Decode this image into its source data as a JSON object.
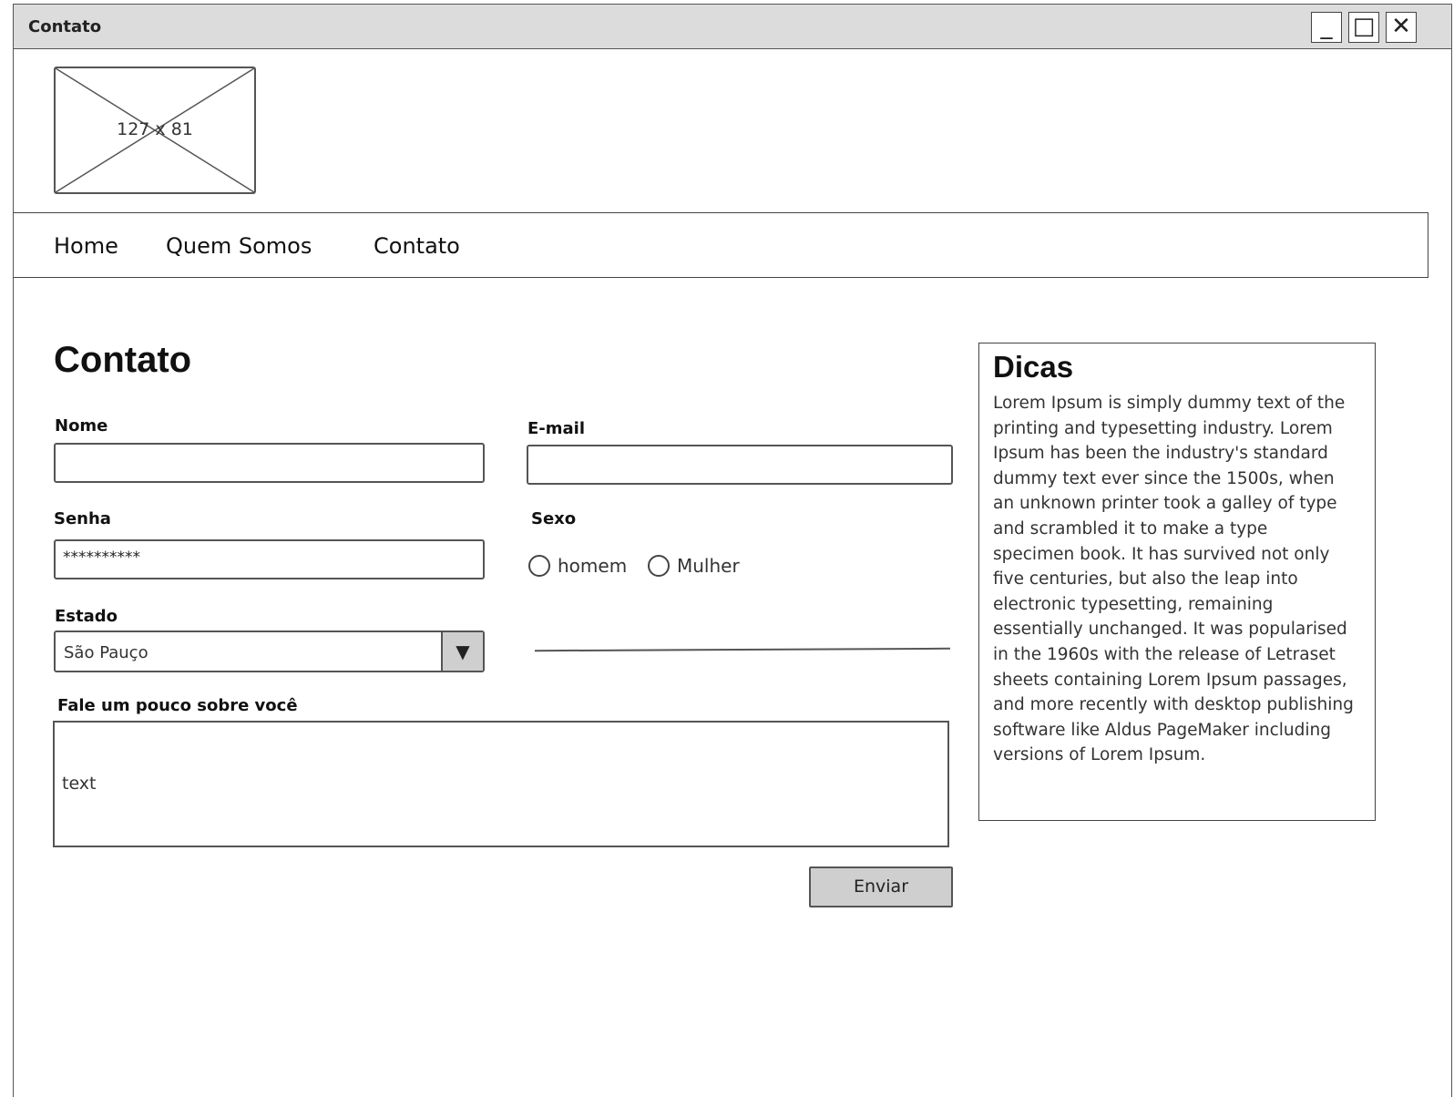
{
  "window": {
    "title": "Contato",
    "controls": {
      "minimize": "_",
      "maximize": "□",
      "close": "✕"
    }
  },
  "header": {
    "logo_placeholder": "127 x 81"
  },
  "nav": {
    "items": [
      {
        "label": "Home"
      },
      {
        "label": "Quem Somos"
      },
      {
        "label": "Contato"
      }
    ]
  },
  "main": {
    "title": "Contato",
    "form": {
      "nome_label": "Nome",
      "nome_value": "",
      "email_label": "E-mail",
      "email_value": "",
      "senha_label": "Senha",
      "senha_value": "**********",
      "sexo_label": "Sexo",
      "sexo_options": [
        {
          "label": "homem",
          "selected": false
        },
        {
          "label": "Mulher",
          "selected": false
        }
      ],
      "estado_label": "Estado",
      "estado_value": "São Pauço",
      "sobre_label": "Fale um pouco sobre você",
      "sobre_value": "text",
      "submit_label": "Enviar"
    }
  },
  "sidebar": {
    "title": "Dicas",
    "text": "Lorem Ipsum is simply dummy text of the printing and typesetting industry. Lorem Ipsum has been the industry's standard dummy text ever since the 1500s, when an unknown printer took a galley of type and scrambled it to make a type specimen book. It has survived not only five centuries, but also the leap into electronic typesetting, remaining essentially unchanged. It was popularised in the 1960s with the release of Letraset sheets containing Lorem Ipsum passages, and more recently with desktop publishing software like Aldus PageMaker including versions of Lorem Ipsum."
  },
  "icons": {
    "dropdown": "triangle-down-icon",
    "image_placeholder": "image-placeholder-icon"
  }
}
